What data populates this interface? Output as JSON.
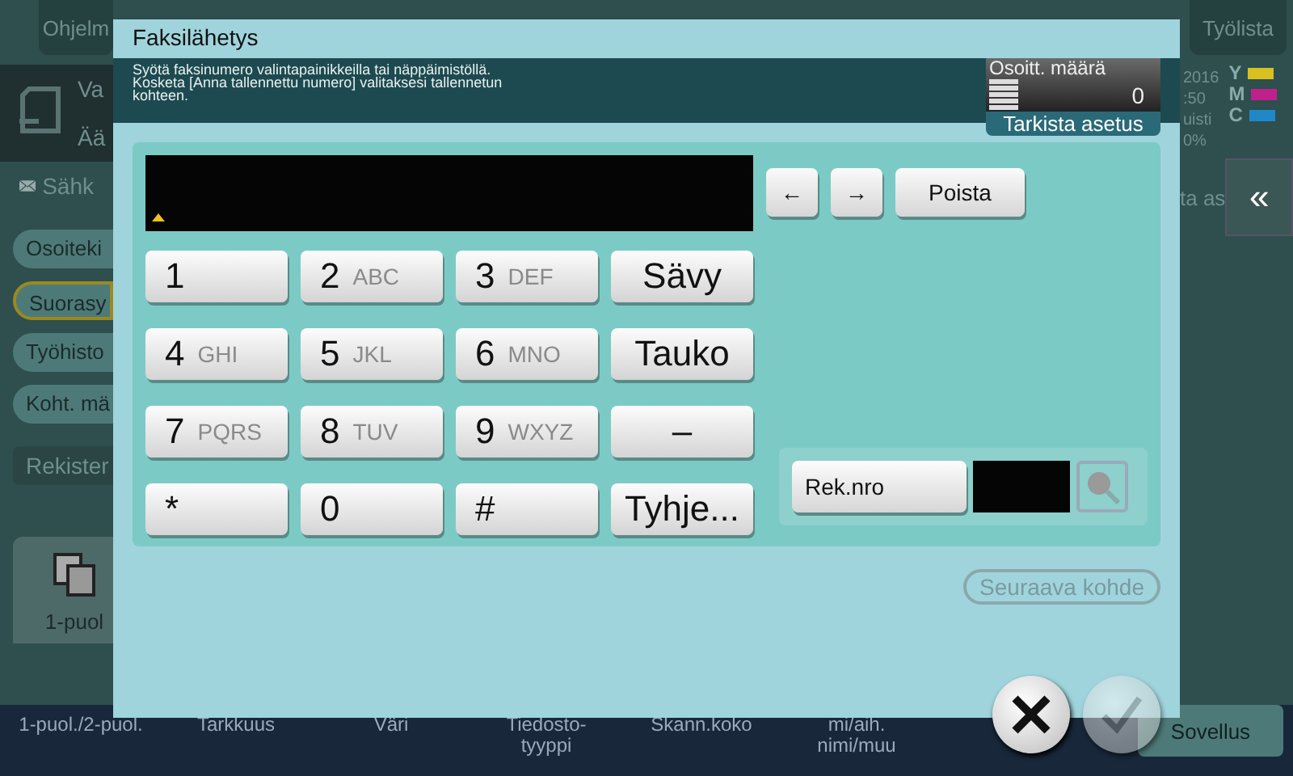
{
  "background": {
    "top_left_button": "Ohjelm",
    "top_right_button": "Työlista",
    "mode_lines": [
      "Va",
      "Ää"
    ],
    "mail_item": "Sähk",
    "side_tabs": [
      {
        "label": "Osoiteki",
        "selected": false
      },
      {
        "label": "Suorasy",
        "selected": true
      },
      {
        "label": "Työhisto",
        "selected": false
      },
      {
        "label": "Koht. mä",
        "selected": false
      }
    ],
    "register_button": {
      "label": "Rekister",
      "disabled": true
    },
    "tile": "1-puol",
    "status_lines": [
      "2016",
      ":50",
      "uisti",
      "0%"
    ],
    "toners": [
      {
        "label": "Y",
        "color": "#d8c020"
      },
      {
        "label": "M",
        "color": "#c0208c"
      },
      {
        "label": "C",
        "color": "#2088c8"
      }
    ],
    "side_text": "ta as",
    "back_button": "«",
    "bottom_labels": [
      "1-puol./2-puol.",
      "Tarkkuus",
      "Väri",
      "Tiedosto-\ntyyppi",
      "Skann.koko",
      "mi/aih.\nnimi/muu"
    ],
    "app_button": "Sovellus"
  },
  "dialog": {
    "title": "Faksilähetys",
    "message": [
      "Syötä faksinumero valintapainikkeilla tai näppäimistöllä.",
      "Kosketa [Anna tallennettu numero] valitaksesi tallennetun kohteen."
    ],
    "counter": {
      "label": "Osoitt. määrä",
      "value": "0"
    },
    "check_button": "Tarkista asetus",
    "arrows": [
      "←",
      "→"
    ],
    "delete_button": "Poista",
    "keys": [
      {
        "kind": "digit",
        "label": "1"
      },
      {
        "kind": "digit",
        "label": "2",
        "letters": "ABC"
      },
      {
        "kind": "digit",
        "label": "3",
        "letters": "DEF"
      },
      {
        "kind": "word",
        "label": "Sävy"
      },
      {
        "kind": "digit",
        "label": "4",
        "letters": "GHI"
      },
      {
        "kind": "digit",
        "label": "5",
        "letters": "JKL"
      },
      {
        "kind": "digit",
        "label": "6",
        "letters": "MNO"
      },
      {
        "kind": "word",
        "label": "Tauko"
      },
      {
        "kind": "digit",
        "label": "7",
        "letters": "PQRS"
      },
      {
        "kind": "digit",
        "label": "8",
        "letters": "TUV"
      },
      {
        "kind": "digit",
        "label": "9",
        "letters": "WXYZ"
      },
      {
        "kind": "word",
        "label": "–"
      },
      {
        "kind": "digit",
        "label": "*"
      },
      {
        "kind": "digit",
        "label": "0"
      },
      {
        "kind": "digit",
        "label": "#"
      },
      {
        "kind": "word",
        "label": "Tyhje..."
      }
    ],
    "reg_button": "Rek.nro",
    "search_disabled": true,
    "next_button": {
      "label": "Seuraava kohde",
      "disabled": true
    },
    "ok_disabled": true
  }
}
